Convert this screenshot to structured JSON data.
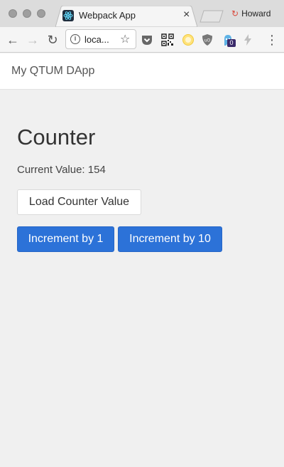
{
  "browser": {
    "tab": {
      "title": "Webpack App",
      "close_glyph": "×",
      "favicon": "react-icon"
    },
    "profile": {
      "name": "Howard",
      "icon": "profile-icon",
      "accent": "#d9483b"
    },
    "toolbar": {
      "back_glyph": "←",
      "forward_glyph": "→",
      "reload_glyph": "↻",
      "url": "loca...",
      "info_glyph": "i",
      "star_glyph": "☆",
      "menu_glyph": "⋮",
      "extension_badge": "0",
      "extensions": [
        "pocket-icon",
        "qr-code-icon",
        "circle-extension-icon",
        "ublock-shield-icon",
        "ghostery-icon",
        "bolt-icon"
      ]
    }
  },
  "app": {
    "brand": "My QTUM DApp",
    "heading": "Counter",
    "current_value_text": "Current Value: 154",
    "buttons": {
      "load": "Load Counter Value",
      "increment_1": "Increment by 1",
      "increment_10": "Increment by 10"
    },
    "colors": {
      "primary": "#2c72d8",
      "background": "#f0f0f0"
    }
  }
}
